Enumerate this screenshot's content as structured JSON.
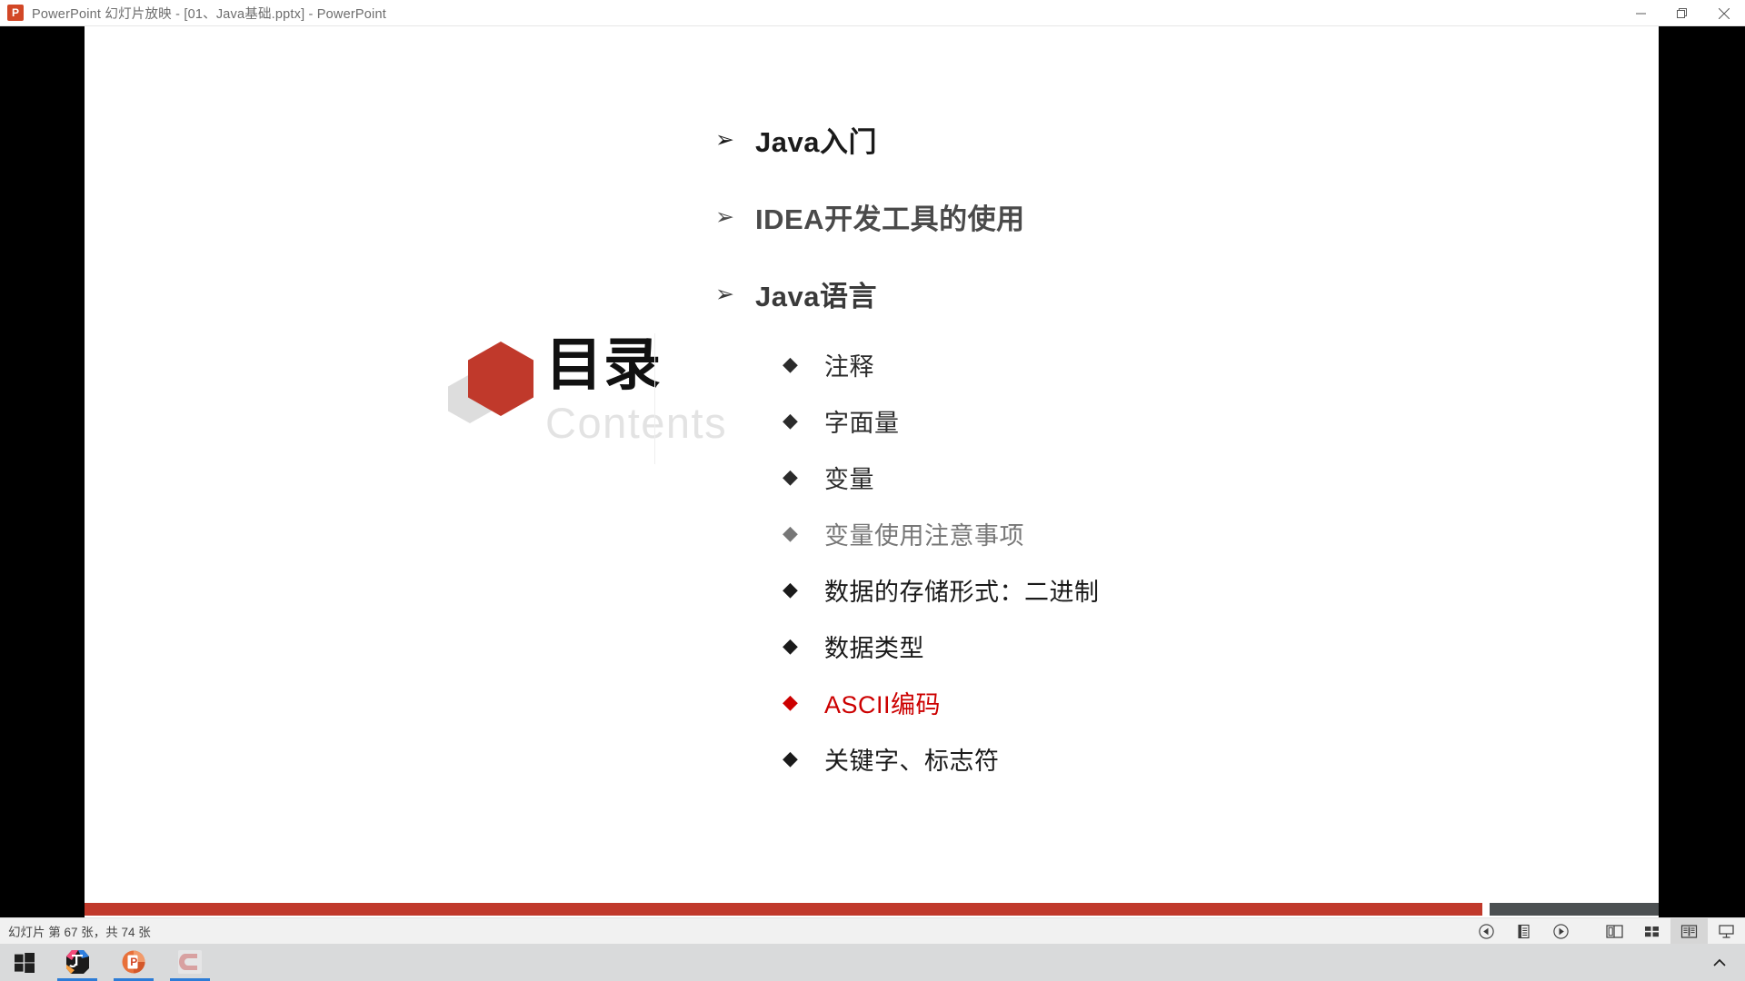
{
  "window": {
    "title": "PowerPoint 幻灯片放映 - [01、Java基础.pptx] - PowerPoint",
    "app_icon": "powerpoint-icon",
    "controls": {
      "minimize": "最小化",
      "restore": "向下还原",
      "close": "关闭"
    }
  },
  "slide": {
    "logo": {
      "title_cn": "目录",
      "title_en": "Contents"
    },
    "outline": {
      "level1": [
        {
          "bullet": "➢",
          "label": "Java入门",
          "color": "#1a1a1a"
        },
        {
          "bullet": "➢",
          "label": "IDEA开发工具的使用",
          "color": "#4a4a4a"
        },
        {
          "bullet": "➢",
          "label": "Java语言",
          "color": "#3a3a3a"
        }
      ],
      "level2": [
        {
          "bullet": "◆",
          "label": "注释",
          "color": "#2b2b2b"
        },
        {
          "bullet": "◆",
          "label": "字面量",
          "color": "#2b2b2b"
        },
        {
          "bullet": "◆",
          "label": "变量",
          "color": "#2b2b2b"
        },
        {
          "bullet": "◆",
          "label": "变量使用注意事项",
          "color": "#777777"
        },
        {
          "bullet": "◆",
          "label": "数据的存储形式：二进制",
          "color": "#1a1a1a"
        },
        {
          "bullet": "◆",
          "label": "数据类型",
          "color": "#1a1a1a"
        },
        {
          "bullet": "◆",
          "label": "ASCII编码",
          "color": "#cc0000"
        },
        {
          "bullet": "◆",
          "label": "关键字、标志符",
          "color": "#1a1a1a"
        }
      ]
    },
    "progress": {
      "percent": 88.8,
      "done_color": "#c0392b",
      "rest_color": "#4c5052"
    }
  },
  "statusbar": {
    "slide_counter": "幻灯片 第 67 张，共 74 张",
    "buttons": [
      {
        "name": "previous-slide",
        "icon": "circle-left-icon"
      },
      {
        "name": "notes",
        "icon": "notes-icon"
      },
      {
        "name": "next-slide",
        "icon": "circle-right-icon"
      },
      {
        "name": "normal-view",
        "icon": "normal-view-icon"
      },
      {
        "name": "slide-sorter-view",
        "icon": "slide-sorter-icon"
      },
      {
        "name": "reading-view",
        "icon": "reading-view-icon",
        "active": true
      },
      {
        "name": "slideshow-view",
        "icon": "slideshow-icon"
      }
    ]
  },
  "taskbar": {
    "start": "start-button",
    "apps": [
      {
        "name": "intellij-idea",
        "label": "IJ",
        "running": true
      },
      {
        "name": "powerpoint",
        "label": "P",
        "running": true
      },
      {
        "name": "camtasia",
        "label": "C",
        "running": true
      }
    ],
    "tray": "show-hidden-icons"
  }
}
